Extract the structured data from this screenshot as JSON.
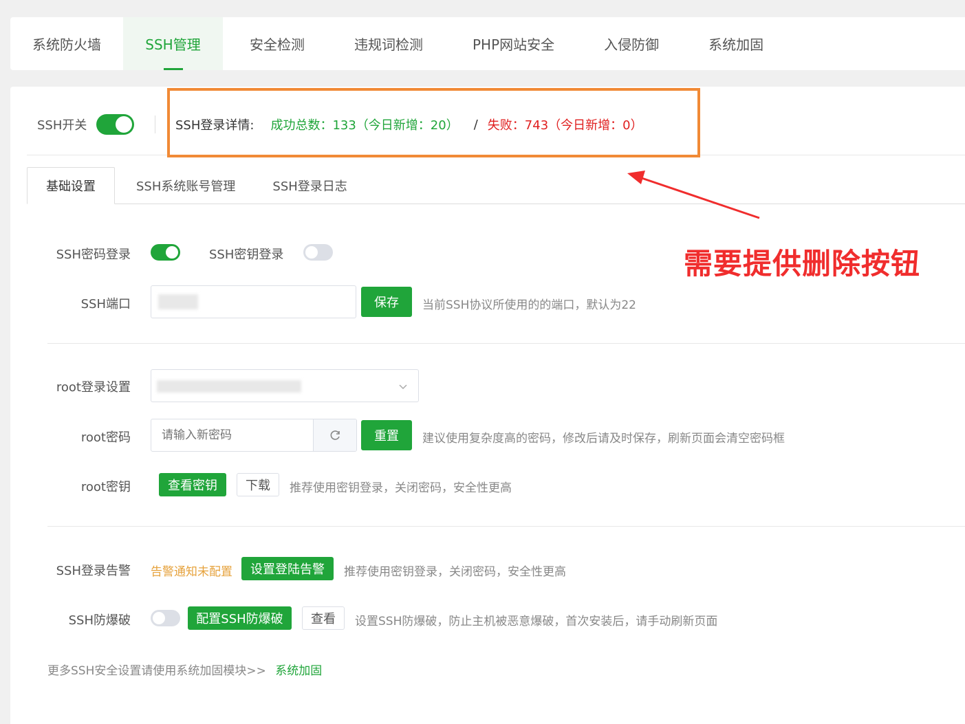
{
  "top_tabs": [
    {
      "label": "系统防火墙"
    },
    {
      "label": "SSH管理"
    },
    {
      "label": "安全检测"
    },
    {
      "label": "违规词检测"
    },
    {
      "label": "PHP网站安全"
    },
    {
      "label": "入侵防御"
    },
    {
      "label": "系统加固"
    }
  ],
  "active_top_tab": "SSH管理",
  "ssh_switch": {
    "label": "SSH开关",
    "state": "on"
  },
  "login_details": {
    "label": "SSH登录详情:",
    "success": "成功总数：133（今日新增：20）",
    "separator": "/",
    "fail": "失败：743（今日新增：0）"
  },
  "annotation": {
    "text": "需要提供删除按钮",
    "color": "#f02d2d",
    "box_color": "#f18a36"
  },
  "sub_tabs": [
    {
      "label": "基础设置"
    },
    {
      "label": "SSH系统账号管理"
    },
    {
      "label": "SSH登录日志"
    }
  ],
  "active_sub_tab": "基础设置",
  "form": {
    "password_login": {
      "label": "SSH密码登录",
      "state": "on"
    },
    "key_login": {
      "label": "SSH密钥登录",
      "state": "off"
    },
    "port": {
      "label": "SSH端口",
      "save": "保存",
      "hint": "当前SSH协议所使用的的端口，默认为22"
    },
    "root_login": {
      "label": "root登录设置"
    },
    "root_password": {
      "label": "root密码",
      "placeholder": "请输入新密码",
      "reset": "重置",
      "hint": "建议使用复杂度高的密码，修改后请及时保存，刷新页面会清空密码框"
    },
    "root_key": {
      "label": "root密钥",
      "view": "查看密钥",
      "download": "下载",
      "hint": "推荐使用密钥登录，关闭密码，安全性更高"
    },
    "alert": {
      "label": "SSH登录告警",
      "status": "告警通知未配置",
      "button": "设置登陆告警",
      "hint": "推荐使用密钥登录，关闭密码，安全性更高"
    },
    "brute": {
      "label": "SSH防爆破",
      "state": "off",
      "config": "配置SSH防爆破",
      "view": "查看",
      "hint": "设置SSH防爆破，防止主机被恶意爆破，首次安装后，请手动刷新页面"
    }
  },
  "footer": {
    "text": "更多SSH安全设置请使用系统加固模块>>",
    "link": "系统加固"
  },
  "colors": {
    "accent": "#20a53a",
    "warning": "#e6a23c",
    "danger": "#e02020"
  },
  "icons": [
    "refresh-icon",
    "chevron-down-icon",
    "arrow-annotation"
  ]
}
